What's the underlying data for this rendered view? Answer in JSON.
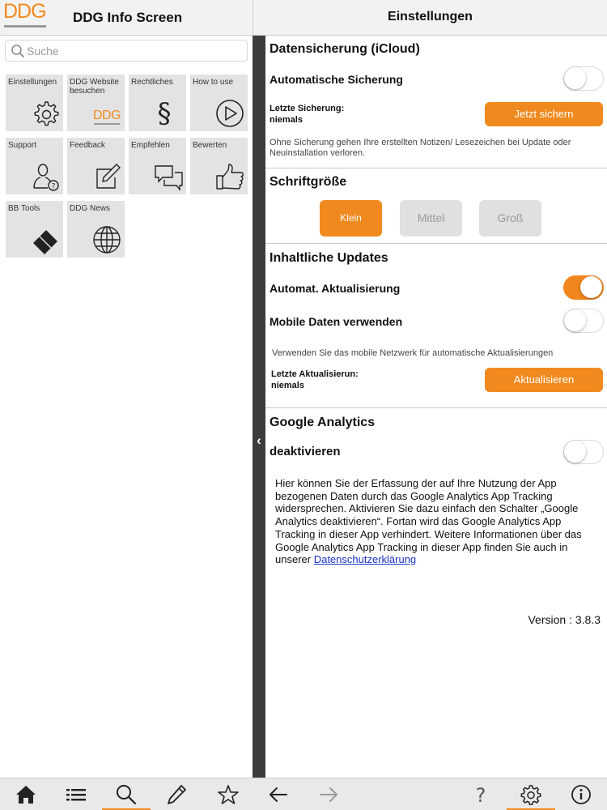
{
  "left": {
    "logo_text": "DDG",
    "title": "DDG Info Screen",
    "search": {
      "placeholder": "Suche",
      "value": ""
    },
    "tiles": [
      {
        "label": "Einstellungen",
        "icon": "gear-icon"
      },
      {
        "label": "DDG Website besuchen",
        "icon": "ddg-logo-icon",
        "icon_text": "DDG"
      },
      {
        "label": "Rechtliches",
        "icon": "paragraph-icon",
        "icon_text": "§"
      },
      {
        "label": "How to use",
        "icon": "play-icon"
      },
      {
        "label": "Support",
        "icon": "support-person-icon"
      },
      {
        "label": "Feedback",
        "icon": "edit-icon"
      },
      {
        "label": "Empfehlen",
        "icon": "chat-bubbles-icon"
      },
      {
        "label": "Bewerten",
        "icon": "thumbs-up-icon"
      },
      {
        "label": "BB Tools",
        "icon": "bb-tools-icon"
      },
      {
        "label": "DDG News",
        "icon": "globe-icon"
      }
    ]
  },
  "right": {
    "title": "Einstellungen",
    "backup": {
      "title": "Datensicherung (iCloud)",
      "auto_label": "Automatische Sicherung",
      "auto_on": false,
      "last_label": "Letzte Sicherung:",
      "last_value": "niemals",
      "button": "Jetzt sichern",
      "info": "Ohne Sicherung gehen Ihre erstellten Notizen/ Lesezeichen bei Update oder Neuinstallation verloren."
    },
    "font_size": {
      "title": "Schriftgröße",
      "options": [
        "Klein",
        "Mittel",
        "Groß"
      ],
      "selected": "Klein"
    },
    "updates": {
      "title": "Inhaltliche Updates",
      "auto_label": "Automat. Aktualisierung",
      "auto_on": true,
      "mobile_label": "Mobile Daten verwenden",
      "mobile_on": false,
      "info": "Verwenden Sie das mobile Netzwerk für automatische Aktualisierungen",
      "last_label": "Letzte Aktualisierun:",
      "last_value": "niemals",
      "button": "Aktualisieren"
    },
    "analytics": {
      "title": "Google Analytics",
      "deactivate_label": "deaktivieren",
      "deactivate_on": false,
      "text": "Hier können Sie der Erfassung der auf Ihre Nutzung der App bezogenen Daten durch das Google Analytics App Tracking widersprechen. Aktivieren Sie dazu einfach den Schalter „Google Analytics deaktivieren“. Fortan wird das Google Analytics App Tracking in dieser App verhindert. Weitere Informationen über das Google Analytics App Tracking in dieser App finden Sie auch in unserer ",
      "link": "Datenschutzerklärung"
    },
    "version": "Version : 3.8.3"
  },
  "bottom_bar": {
    "left_tabs": [
      "home-icon",
      "list-icon",
      "search-icon",
      "pencil-icon",
      "star-icon"
    ],
    "left_selected": "search-icon",
    "right_tabs": [
      "back-arrow-icon",
      "forward-arrow-icon",
      "help-icon",
      "gear-icon",
      "info-icon"
    ],
    "right_selected": "gear-icon"
  },
  "colors": {
    "accent": "#f08a1f",
    "divider": "#3d3d3d",
    "link": "#1a33c8",
    "tile_bg": "#e3e3e3"
  }
}
